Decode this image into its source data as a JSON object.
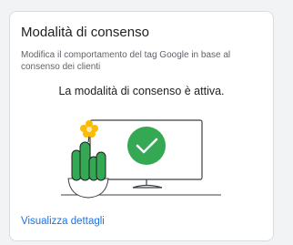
{
  "card": {
    "title": "Modalità di consenso",
    "description": "Modifica il comportamento del tag Google in base al consenso dei clienti",
    "status": "La modalità di consenso è attiva.",
    "link_label": "Visualizza dettagli"
  },
  "colors": {
    "accent": "#1a73e8",
    "success": "#34a853",
    "flower": "#fbbc04"
  },
  "icons": {
    "status_check": "check-circle-icon",
    "plant": "potted-plant-icon"
  }
}
